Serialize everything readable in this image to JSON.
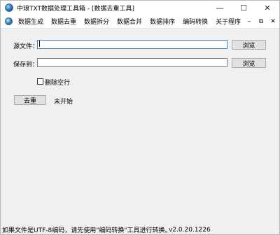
{
  "window": {
    "title": "中琅TXT数据处理工具箱 - [数据去重工具]",
    "controls": {
      "minimize": "—",
      "maximize": "☐",
      "close": "✕"
    }
  },
  "menubar": {
    "items": [
      "数据生成",
      "数据去重",
      "数据拆分",
      "数据合并",
      "数据排序",
      "编码转换",
      "关于程序"
    ],
    "mdi_controls": {
      "minimize": "–",
      "restore": "⧉",
      "close": "✕"
    }
  },
  "form": {
    "source_label": "源文件：",
    "source_value": "",
    "source_browse": "浏览",
    "save_label": "保存到：",
    "save_value": "",
    "save_browse": "浏览",
    "delete_empty_label": "删除空行",
    "delete_empty_checked": false,
    "run_button": "去重",
    "status_text": "未开始"
  },
  "statusbar": {
    "note": "如果文件是UTF-8编码，请先使用\"编码转换\"工具进行转换。",
    "version": "v2.0.20.1226"
  }
}
